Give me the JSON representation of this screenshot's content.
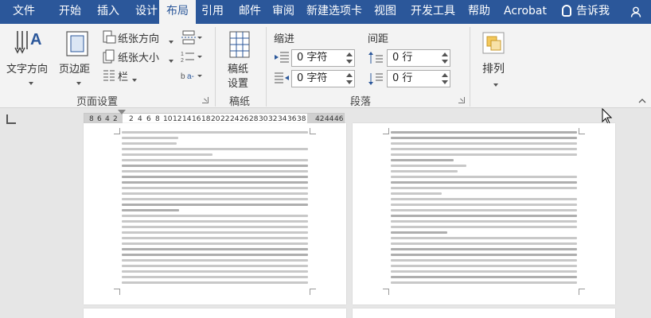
{
  "tabs": [
    "文件",
    "开始",
    "插入",
    "设计",
    "布局",
    "引用",
    "邮件",
    "审阅",
    "新建选项卡",
    "视图",
    "开发工具",
    "帮助",
    "Acrobat",
    "告诉我"
  ],
  "active_tab": "布局",
  "ribbon": {
    "page_setup": {
      "text_direction": "文字方向",
      "margins": "页边距",
      "orientation": "纸张方向",
      "size": "纸张大小",
      "columns": "栏",
      "group_label": "页面设置"
    },
    "manuscript": {
      "button_line1": "稿纸",
      "button_line2": "设置",
      "group_label": "稿纸"
    },
    "paragraph": {
      "indent_label": "缩进",
      "spacing_label": "间距",
      "indent_left": "0 字符",
      "indent_right": "0 字符",
      "spacing_before": "0 行",
      "spacing_after": "0 行",
      "group_label": "段落"
    },
    "arrange": {
      "label": "排列"
    }
  },
  "ruler": {
    "left_numbers": [
      "8",
      "6",
      "4",
      "2"
    ],
    "right_numbers": [
      "2",
      "4",
      "6",
      "8",
      "10",
      "12",
      "14",
      "16",
      "18",
      "20",
      "22",
      "24",
      "26",
      "28",
      "30",
      "32",
      "34",
      "36",
      "38"
    ],
    "end_numbers": [
      "42",
      "44",
      "46"
    ]
  },
  "colors": {
    "ribbon_blue": "#2b579a",
    "ribbon_bg": "#f3f3f3",
    "canvas_bg": "#e6e6e6"
  }
}
